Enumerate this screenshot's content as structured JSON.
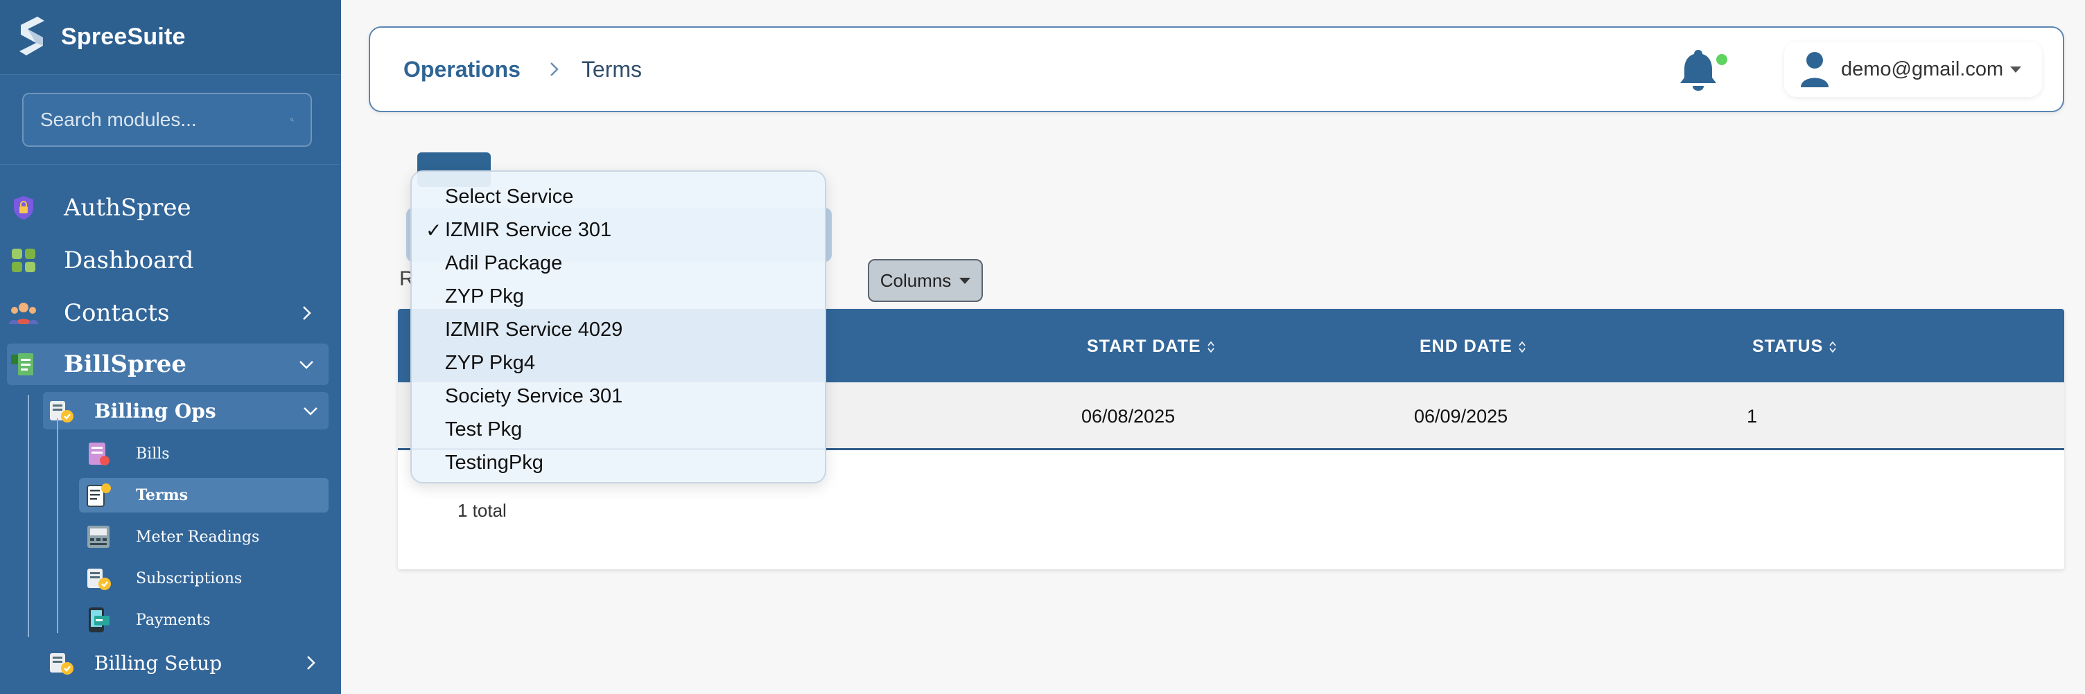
{
  "app": {
    "name": "SpreeSuite"
  },
  "sidebar": {
    "search_placeholder": "Search modules...",
    "items": [
      {
        "label": "AuthSpree",
        "icon": "shield-lock-icon"
      },
      {
        "label": "Dashboard",
        "icon": "dashboard-grid-icon"
      },
      {
        "label": "Contacts",
        "icon": "contacts-group-icon"
      },
      {
        "label": "BillSpree",
        "icon": "bill-doc-icon"
      }
    ],
    "billspree": {
      "groups": [
        {
          "label": "Billing Ops",
          "icon": "billing-ops-icon"
        },
        {
          "label": "Billing Setup",
          "icon": "billing-setup-icon"
        }
      ],
      "leaves": [
        {
          "label": "Bills",
          "icon": "bills-icon"
        },
        {
          "label": "Terms",
          "icon": "terms-icon"
        },
        {
          "label": "Meter Readings",
          "icon": "meter-icon"
        },
        {
          "label": "Subscriptions",
          "icon": "subscriptions-icon"
        },
        {
          "label": "Payments",
          "icon": "payments-icon"
        }
      ]
    }
  },
  "header": {
    "breadcrumb_parent": "Operations",
    "breadcrumb_current": "Terms",
    "user_email": "demo@gmail.com"
  },
  "toolbar": {
    "columns_label": "Columns",
    "r_fragment": "R"
  },
  "table": {
    "headers": [
      "START DATE",
      "END DATE",
      "STATUS"
    ],
    "rows": [
      {
        "start_date": "06/08/2025",
        "end_date": "06/09/2025",
        "status": "1"
      }
    ],
    "total": "1 total"
  },
  "dropdown": {
    "selected": "IZMIR Service 301",
    "options": [
      "Select Service",
      "IZMIR Service 301",
      "Adil Package",
      "ZYP Pkg",
      "IZMIR Service 4029",
      "ZYP Pkg4",
      "Society Service 301",
      "Test Pkg",
      "TestingPkg"
    ],
    "check_glyph": "✓"
  },
  "colors": {
    "sidebar_bg": "#326699",
    "accent": "#2f6594",
    "notification_dot": "#5fd35f"
  }
}
